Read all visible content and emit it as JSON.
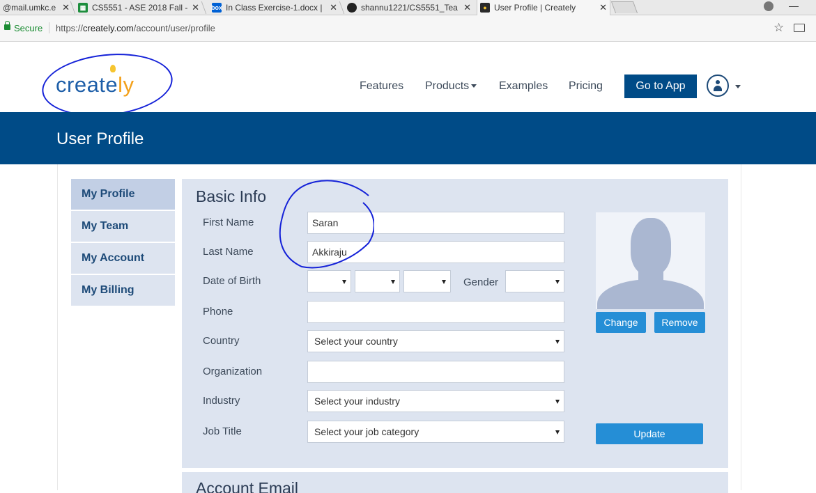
{
  "browser": {
    "tabs": [
      {
        "title": "@mail.umkc.e",
        "favicon": "mail-icon",
        "active": false
      },
      {
        "title": "CS5551 - ASE 2018 Fall -",
        "favicon": "sheets-icon",
        "active": false
      },
      {
        "title": "In Class Exercise-1.docx |",
        "favicon": "box-icon",
        "active": false
      },
      {
        "title": "shannu1221/CS5551_Tea",
        "favicon": "github-icon",
        "active": false
      },
      {
        "title": "User Profile | Creately",
        "favicon": "creately-icon",
        "active": true
      }
    ],
    "secure_label": "Secure",
    "url_scheme": "https://",
    "url_host": "creately.com",
    "url_path": "/account/user/profile"
  },
  "header": {
    "logo_text_a": "create",
    "logo_text_b": "ly",
    "nav": {
      "features": "Features",
      "products": "Products",
      "examples": "Examples",
      "pricing": "Pricing"
    },
    "go_to_app": "Go to App"
  },
  "page_title": "User Profile",
  "sidebar": {
    "items": [
      {
        "label": "My Profile",
        "active": true
      },
      {
        "label": "My Team",
        "active": false
      },
      {
        "label": "My Account",
        "active": false
      },
      {
        "label": "My Billing",
        "active": false
      }
    ]
  },
  "basic_info": {
    "title": "Basic Info",
    "labels": {
      "first_name": "First Name",
      "last_name": "Last Name",
      "dob": "Date of Birth",
      "gender": "Gender",
      "phone": "Phone",
      "country": "Country",
      "organization": "Organization",
      "industry": "Industry",
      "job_title": "Job Title"
    },
    "values": {
      "first_name": "Saran",
      "last_name": "Akkiraju",
      "dob_day": "",
      "dob_month": "",
      "dob_year": "",
      "gender": "",
      "phone": "",
      "country": "Select your country",
      "organization": "",
      "industry": "Select your industry",
      "job_title": "Select your job category"
    },
    "buttons": {
      "change": "Change",
      "remove": "Remove",
      "update": "Update"
    }
  },
  "account_email": {
    "title": "Account Email"
  },
  "colors": {
    "brand_blue": "#004b87",
    "button_blue": "#258ed6",
    "panel_bg": "#dde4f0",
    "annotation_pen": "#1522d8"
  }
}
